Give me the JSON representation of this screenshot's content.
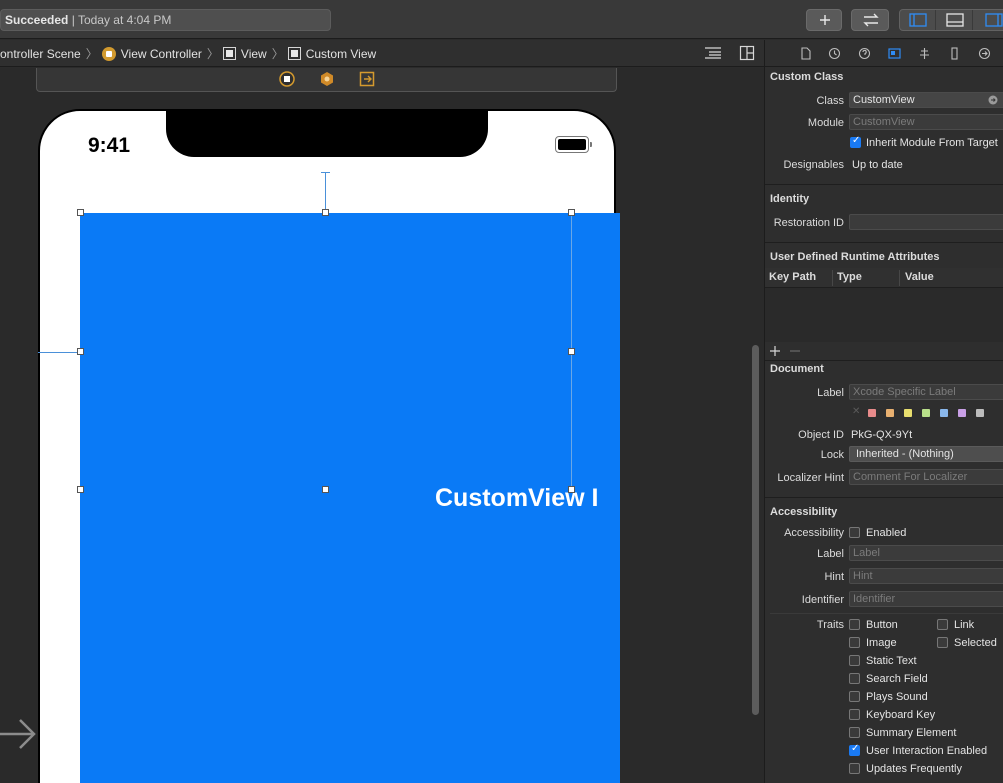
{
  "toolbar": {
    "status_bold": "Succeeded",
    "status_rest": " | Today at 4:04 PM"
  },
  "jumpbar": {
    "crumbs": [
      "ontroller Scene",
      "View Controller",
      "View",
      "Custom View"
    ]
  },
  "canvas": {
    "time": "9:41",
    "custom_view_label": "CustomView I"
  },
  "inspector": {
    "custom_class": {
      "title": "Custom Class",
      "class_label": "Class",
      "class_value": "CustomView",
      "module_label": "Module",
      "module_placeholder": "CustomView",
      "inherit_label": "Inherit Module From Target",
      "designables_label": "Designables",
      "designables_value": "Up to date"
    },
    "identity": {
      "title": "Identity",
      "restoration_label": "Restoration ID"
    },
    "runtime_attrs": {
      "title": "User Defined Runtime Attributes",
      "columns": [
        "Key Path",
        "Type",
        "Value"
      ]
    },
    "document": {
      "title": "Document",
      "label_label": "Label",
      "label_placeholder": "Xcode Specific Label",
      "colors": [
        "#e88b8b",
        "#e8b070",
        "#e8de6e",
        "#b9e08a",
        "#8ab8ec",
        "#c9a0e6",
        "#bcbcbc"
      ],
      "object_id_label": "Object ID",
      "object_id_value": "PkG-QX-9Yt",
      "lock_label": "Lock",
      "lock_value": "Inherited - (Nothing)",
      "localizer_label": "Localizer Hint",
      "localizer_placeholder": "Comment For Localizer"
    },
    "accessibility": {
      "title": "Accessibility",
      "accessibility_label": "Accessibility",
      "enabled_label": "Enabled",
      "label_label": "Label",
      "label_placeholder": "Label",
      "hint_label": "Hint",
      "hint_placeholder": "Hint",
      "identifier_label": "Identifier",
      "identifier_placeholder": "Identifier",
      "traits_label": "Traits",
      "traits": {
        "button": "Button",
        "link": "Link",
        "image": "Image",
        "selected": "Selected",
        "static_text": "Static Text",
        "search_field": "Search Field",
        "plays_sound": "Plays Sound",
        "keyboard_key": "Keyboard Key",
        "summary_element": "Summary Element",
        "user_interaction": "User Interaction Enabled",
        "updates_frequently": "Updates Frequently"
      }
    }
  }
}
